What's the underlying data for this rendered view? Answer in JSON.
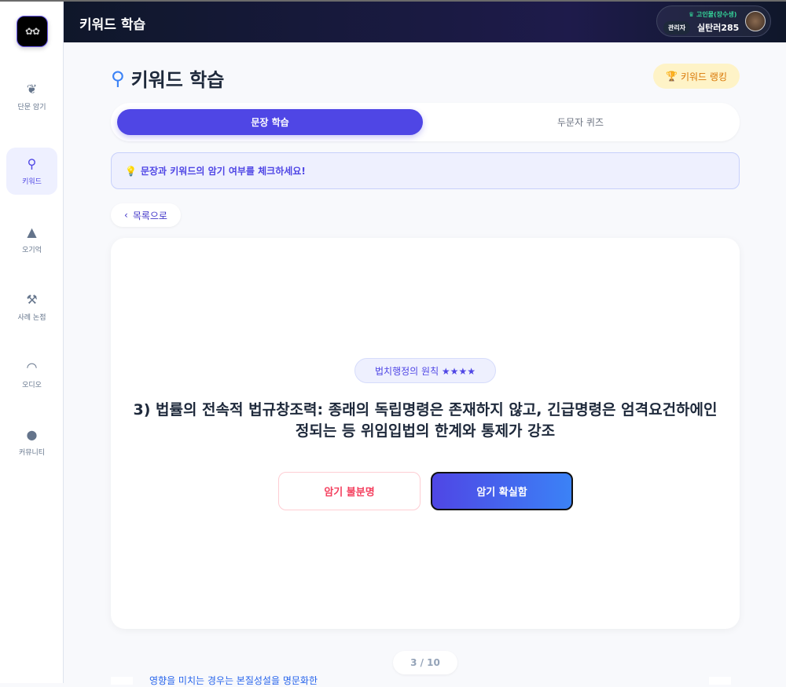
{
  "header": {
    "title": "키워드 학습"
  },
  "user": {
    "grade": "♛ 고인물(장수생)",
    "role": "관리자",
    "name": "실탄러285"
  },
  "sidebar": {
    "logo": "✿✿",
    "items": [
      {
        "label": "단문 암기",
        "icon": "brain-icon",
        "glyph": "❦"
      },
      {
        "label": "키워드",
        "icon": "search-icon",
        "glyph": "⚲"
      },
      {
        "label": "오기억",
        "icon": "warning-icon",
        "glyph": "▲"
      },
      {
        "label": "사례 논점",
        "icon": "gavel-icon",
        "glyph": "⚒"
      },
      {
        "label": "오디오",
        "icon": "headphones-icon",
        "glyph": "◠"
      },
      {
        "label": "커뮤니티",
        "icon": "comments-icon",
        "glyph": "●"
      }
    ]
  },
  "page": {
    "title": "키워드 학습",
    "ranking_label": "키워드 랭킹",
    "tabs": [
      "문장 학습",
      "두문자 퀴즈"
    ],
    "notice": "문장과 키워드의 암기 여부를 체크하세요!",
    "back_label": "목록으로"
  },
  "card": {
    "tag": "법치행정의 원칙 ★★★★",
    "sentence": "3) 법률의 전속적 법규창조력: 종래의 독립명령은 존재하지 않고, 긴급명령은 엄격요건하에인정되는 등 위임입법의 한계와 통제가 강조",
    "unsure_label": "암기 불분명",
    "sure_label": "암기 확실함"
  },
  "pager": "3 / 10",
  "next_peek": "영향을 미치는 경우는 본질성설을 명문화한",
  "colors": {
    "accent": "#4f46e5",
    "header": "#0f172a",
    "rank_bg": "#fef3c7",
    "unsure": "#f43f5e"
  }
}
